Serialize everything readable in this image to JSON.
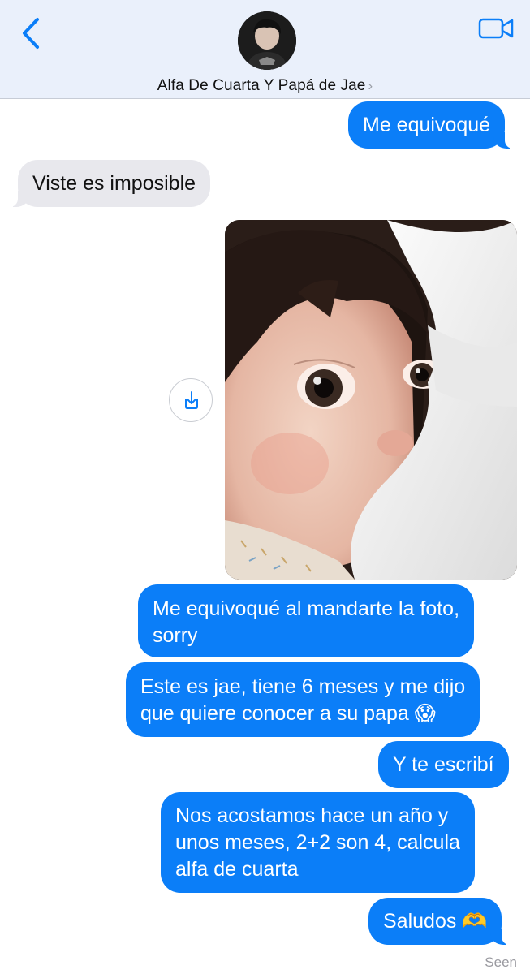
{
  "header": {
    "contact_name": "Alfa De Cuarta Y Papá de Jae",
    "chevron": "›",
    "back_icon": "chevron-left-icon",
    "video_icon": "video-camera-icon",
    "accent": "#0b7ef8"
  },
  "messages": [
    {
      "from": "me",
      "text": "Me equivoqué"
    },
    {
      "from": "them",
      "text": "Viste es imposible"
    },
    {
      "from": "them",
      "type": "photo",
      "content": "baby photo",
      "action_icon": "save-download-icon"
    },
    {
      "from": "me",
      "lines": [
        "Me equivoqué al mandarte la foto,",
        "sorry"
      ]
    },
    {
      "from": "me",
      "lines": [
        "Este es jae, tiene 6 meses y me dijo",
        "que quiere conocer a su papa 😱"
      ]
    },
    {
      "from": "me",
      "text": "Y te escribí"
    },
    {
      "from": "me",
      "lines": [
        "Nos acostamos hace un año y",
        "unos meses, 2+2 son 4, calcula",
        "alfa de cuarta"
      ]
    },
    {
      "from": "me",
      "text": "Saludos 🫶"
    }
  ],
  "status": {
    "seen": "Seen"
  },
  "colors": {
    "outgoing": "#0b7ef8",
    "incoming": "#e8e8ed",
    "header_bg": "#eaf0fb"
  }
}
